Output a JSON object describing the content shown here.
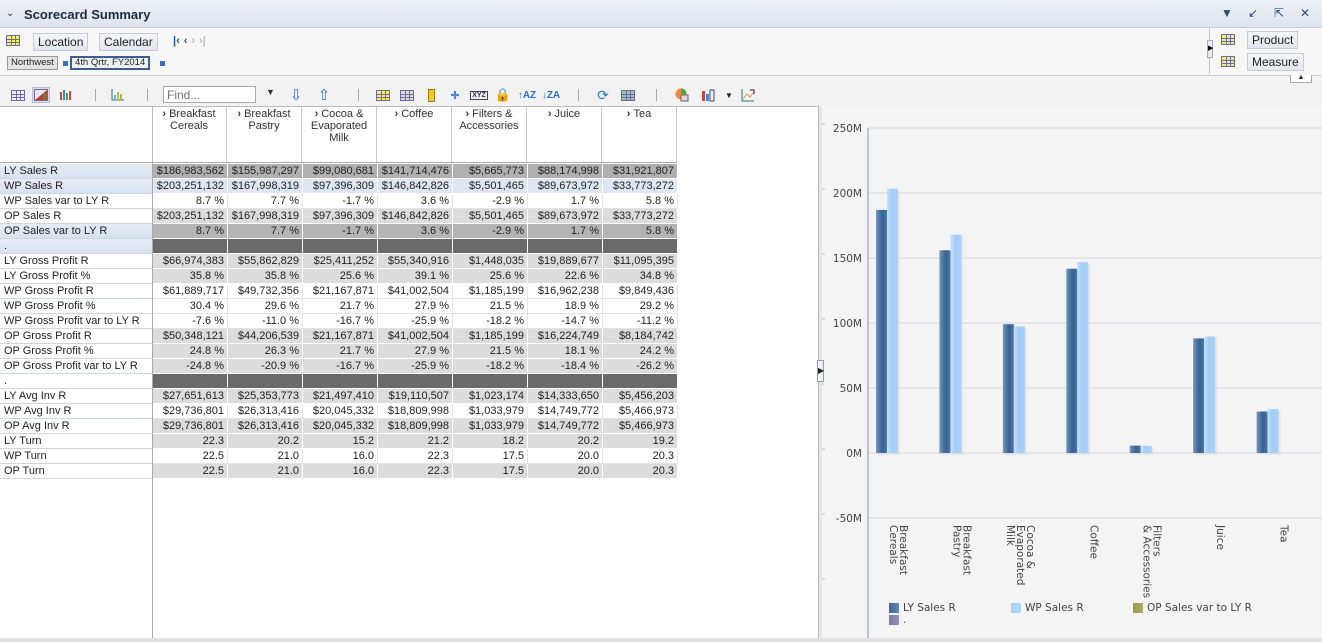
{
  "window": {
    "title": "Scorecard Summary",
    "collapse_icon": "chevron-down-icon",
    "controls": [
      "dropdown-icon",
      "minimize-icon",
      "restore-icon",
      "close-icon"
    ]
  },
  "pov": {
    "left_dimensions": [
      "Location",
      "Calendar"
    ],
    "nav": [
      "first",
      "previous",
      "next",
      "last"
    ],
    "selections": [
      "Northwest",
      "4th Qrtr, FY2014"
    ],
    "right_dimensions": [
      "Product",
      "Measure"
    ]
  },
  "toolbar": {
    "find_placeholder": "Find...",
    "buttons": [
      "grid-view",
      "grid-chart-view",
      "chart-view",
      "chart-type",
      "find-down",
      "find-up",
      "insert-column",
      "select-cells",
      "ruler",
      "split",
      "xyz-format",
      "lock",
      "sort-ascending",
      "sort-descending",
      "refresh",
      "export",
      "chart-options",
      "chart-layout",
      "chart-swap"
    ]
  },
  "table": {
    "columns": [
      {
        "label": "Breakfast Cereals"
      },
      {
        "label": "Breakfast Pastry"
      },
      {
        "label": "Cocoa & Evaporated Milk"
      },
      {
        "label": "Coffee"
      },
      {
        "label": "Filters & Accessories"
      },
      {
        "label": "Juice"
      },
      {
        "label": "Tea"
      }
    ],
    "rows": [
      {
        "label": "LY Sales R",
        "style": "dark",
        "hl": true,
        "values": [
          "$186,983,562",
          "$155,987,297",
          "$99,080,681",
          "$141,714,476",
          "$5,665,773",
          "$88,174,998",
          "$31,921,807"
        ]
      },
      {
        "label": "WP Sales R",
        "style": "blue",
        "hl": true,
        "values": [
          "$203,251,132",
          "$167,998,319",
          "$97,396,309",
          "$146,842,826",
          "$5,501,465",
          "$89,673,972",
          "$33,773,272"
        ]
      },
      {
        "label": "WP Sales var to LY R",
        "style": "white",
        "hl": false,
        "values": [
          "8.7 %",
          "7.7 %",
          "-1.7 %",
          "3.6 %",
          "-2.9 %",
          "1.7 %",
          "5.8 %"
        ]
      },
      {
        "label": "OP Sales R",
        "style": "light",
        "hl": false,
        "values": [
          "$203,251,132",
          "$167,998,319",
          "$97,396,309",
          "$146,842,826",
          "$5,501,465",
          "$89,673,972",
          "$33,773,272"
        ]
      },
      {
        "label": "OP Sales var to LY R",
        "style": "mid",
        "hl": true,
        "values": [
          "8.7 %",
          "7.7 %",
          "-1.7 %",
          "3.6 %",
          "-2.9 %",
          "1.7 %",
          "5.8 %"
        ]
      },
      {
        "label": ".",
        "style": "sep",
        "hl": true,
        "values": [
          "",
          "",
          "",
          "",
          "",
          "",
          ""
        ]
      },
      {
        "label": "LY Gross Profit R",
        "style": "light",
        "hl": false,
        "values": [
          "$66,974,383",
          "$55,862,829",
          "$25,411,252",
          "$55,340,916",
          "$1,448,035",
          "$19,889,677",
          "$11,095,395"
        ]
      },
      {
        "label": "LY Gross Profit %",
        "style": "light",
        "hl": false,
        "values": [
          "35.8 %",
          "35.8 %",
          "25.6 %",
          "39.1 %",
          "25.6 %",
          "22.6 %",
          "34.8 %"
        ]
      },
      {
        "label": "WP Gross Profit R",
        "style": "white",
        "hl": false,
        "values": [
          "$61,889,717",
          "$49,732,356",
          "$21,167,871",
          "$41,002,504",
          "$1,185,199",
          "$16,962,238",
          "$9,849,436"
        ]
      },
      {
        "label": "WP Gross Profit %",
        "style": "white",
        "hl": false,
        "values": [
          "30.4 %",
          "29.6 %",
          "21.7 %",
          "27.9 %",
          "21.5 %",
          "18.9 %",
          "29.2 %"
        ]
      },
      {
        "label": "WP Gross Profit var to LY R",
        "style": "white",
        "hl": false,
        "values": [
          "-7.6 %",
          "-11.0 %",
          "-16.7 %",
          "-25.9 %",
          "-18.2 %",
          "-14.7 %",
          "-11.2 %"
        ]
      },
      {
        "label": "OP Gross Profit R",
        "style": "light",
        "hl": false,
        "values": [
          "$50,348,121",
          "$44,206,539",
          "$21,167,871",
          "$41,002,504",
          "$1,185,199",
          "$16,224,749",
          "$8,184,742"
        ]
      },
      {
        "label": "OP Gross Profit %",
        "style": "light",
        "hl": false,
        "values": [
          "24.8 %",
          "26.3 %",
          "21.7 %",
          "27.9 %",
          "21.5 %",
          "18.1 %",
          "24.2 %"
        ]
      },
      {
        "label": "OP Gross Profit var to LY R",
        "style": "light",
        "hl": false,
        "values": [
          "-24.8 %",
          "-20.9 %",
          "-16.7 %",
          "-25.9 %",
          "-18.2 %",
          "-18.4 %",
          "-26.2 %"
        ]
      },
      {
        "label": ".",
        "style": "sep",
        "hl": false,
        "values": [
          "",
          "",
          "",
          "",
          "",
          "",
          ""
        ]
      },
      {
        "label": "LY Avg Inv R",
        "style": "light",
        "hl": false,
        "values": [
          "$27,651,613",
          "$25,353,773",
          "$21,497,410",
          "$19,110,507",
          "$1,023,174",
          "$14,333,650",
          "$5,456,203"
        ]
      },
      {
        "label": "WP Avg Inv R",
        "style": "white",
        "hl": false,
        "values": [
          "$29,736,801",
          "$26,313,416",
          "$20,045,332",
          "$18,809,998",
          "$1,033,979",
          "$14,749,772",
          "$5,466,973"
        ]
      },
      {
        "label": "OP Avg Inv R",
        "style": "light",
        "hl": false,
        "values": [
          "$29,736,801",
          "$26,313,416",
          "$20,045,332",
          "$18,809,998",
          "$1,033,979",
          "$14,749,772",
          "$5,466,973"
        ]
      },
      {
        "label": "LY Turn",
        "style": "light",
        "hl": false,
        "values": [
          "22.3",
          "20.2",
          "15.2",
          "21.2",
          "18.2",
          "20.2",
          "19.2"
        ]
      },
      {
        "label": "WP Turn",
        "style": "white",
        "hl": false,
        "values": [
          "22.5",
          "21.0",
          "16.0",
          "22.3",
          "17.5",
          "20.0",
          "20.3"
        ]
      },
      {
        "label": "OP Turn",
        "style": "light",
        "hl": false,
        "values": [
          "22.5",
          "21.0",
          "16.0",
          "22.3",
          "17.5",
          "20.0",
          "20.3"
        ]
      }
    ]
  },
  "chart_data": {
    "type": "bar",
    "categories": [
      "Breakfast Cereals",
      "Breakfast Pastry",
      "Cocoa & Evaporated Milk",
      "Coffee",
      "Filters & Accessories",
      "Juice",
      "Tea"
    ],
    "series": [
      {
        "name": "LY Sales R",
        "color": "#3d6a9c",
        "values": [
          186983562,
          155987297,
          99080681,
          141714476,
          5665773,
          88174998,
          31921807
        ]
      },
      {
        "name": "WP Sales R",
        "color": "#a6cff8",
        "values": [
          203251132,
          167998319,
          97396309,
          146842826,
          5501465,
          89673972,
          33773272
        ]
      }
    ],
    "legend": [
      {
        "name": "LY Sales R",
        "color": "#3d6a9c"
      },
      {
        "name": "WP Sales R",
        "color": "#a6cff8"
      },
      {
        "name": "OP Sales var to LY R",
        "color": "#9a9a4a"
      },
      {
        "name": ".",
        "color": "#7a78a8"
      }
    ],
    "yticks": [
      "-50M",
      "0M",
      "50M",
      "100M",
      "150M",
      "200M",
      "250M"
    ],
    "ylim": [
      -50000000,
      250000000
    ],
    "grid": true,
    "legend_position": "bottom",
    "title": "",
    "xlabel": "",
    "ylabel": ""
  }
}
